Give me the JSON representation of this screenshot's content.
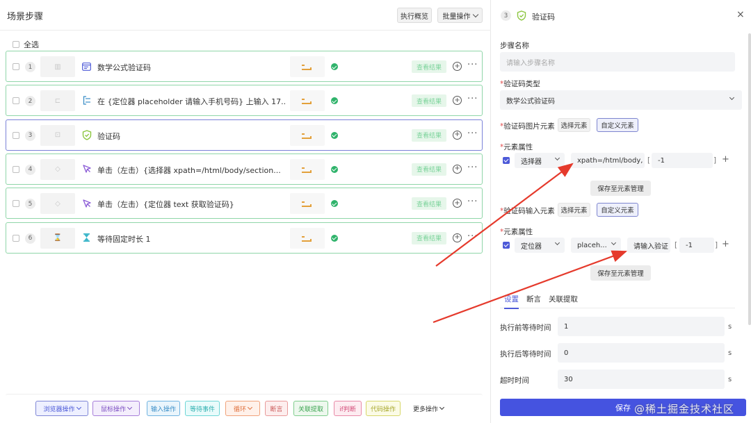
{
  "left_panel": {
    "title": "场景步骤",
    "run_overview_label": "执行概览",
    "batch_label": "批量操作",
    "select_all_label": "全选",
    "steps": [
      {
        "num": "1",
        "label": "数学公式验证码",
        "icon": "form-icon",
        "result": "查看结果"
      },
      {
        "num": "2",
        "label": "在 {定位器 placeholder 请输入手机号码} 上输入 17...",
        "icon": "input-bracket-icon",
        "result": "查看结果"
      },
      {
        "num": "3",
        "label": "验证码",
        "icon": "shield-check-icon",
        "result": "查看结果"
      },
      {
        "num": "4",
        "label": "单击（左击）{选择器 xpath=/html/body/section...",
        "icon": "cursor-click-icon",
        "result": "查看结果"
      },
      {
        "num": "5",
        "label": "单击（左击）{定位器 text 获取验证码}",
        "icon": "cursor-click-icon",
        "result": "查看结果"
      },
      {
        "num": "6",
        "label": "等待固定时长 1",
        "icon": "hourglass-icon",
        "result": "查看结果"
      }
    ],
    "toolbar": [
      {
        "label": "浏览器操作",
        "dropdown": true,
        "bg": "#eef0ff",
        "border": "#7e86d6",
        "color": "#4d5ad8"
      },
      {
        "label": "鼠标操作",
        "dropdown": true,
        "bg": "#f4eefc",
        "border": "#a67dd9",
        "color": "#7d4fc2"
      },
      {
        "label": "输入操作",
        "dropdown": false,
        "bg": "#eaf5fc",
        "border": "#6fb3e0",
        "color": "#3b8ec7"
      },
      {
        "label": "等待事件",
        "dropdown": false,
        "bg": "#e9fbfb",
        "border": "#6fd6d6",
        "color": "#2fb0b0"
      },
      {
        "label": "循环",
        "dropdown": true,
        "bg": "#fff1ea",
        "border": "#f0a27a",
        "color": "#e0713d"
      },
      {
        "label": "断言",
        "dropdown": false,
        "bg": "#fdeeee",
        "border": "#e99a9a",
        "color": "#cc5c5c"
      },
      {
        "label": "关联提取",
        "dropdown": false,
        "bg": "#edf8ee",
        "border": "#7fcd8d",
        "color": "#3da552"
      },
      {
        "label": "if判断",
        "dropdown": false,
        "bg": "#fdecf1",
        "border": "#e88aa8",
        "color": "#d44d7a"
      },
      {
        "label": "代码操作",
        "dropdown": false,
        "bg": "#fbfbe6",
        "border": "#d7d76a",
        "color": "#a8a82e"
      },
      {
        "label": "更多操作",
        "dropdown": true,
        "bg": "#ffffff",
        "border": "#ffffff",
        "color": "#333333"
      }
    ]
  },
  "right_panel": {
    "step_num": "3",
    "title": "验证码",
    "close": "×",
    "step_name_label": "步骤名称",
    "step_name_placeholder": "请输入步骤名称",
    "captcha_type_label": "验证码类型",
    "captcha_type_value": "数学公式验证码",
    "req_mark": "*",
    "img_element_label": "验证码图片元素",
    "select_element": "选择元素",
    "custom_element": "自定义元素",
    "attr_label": "元素属性",
    "attr1": {
      "type": "选择器",
      "value": "xpath=/html/body,",
      "index": "-1"
    },
    "save_to_manager": "保存至元素管理",
    "input_element_label": "验证码输入元素",
    "attr2": {
      "type": "定位器",
      "sub": "placeh...",
      "value": "请输入验证",
      "index": "-1"
    },
    "tabs": [
      "设置",
      "断言",
      "关联提取"
    ],
    "before_wait_label": "执行前等待时间",
    "before_wait_value": "1",
    "after_wait_label": "执行后等待时间",
    "after_wait_value": "0",
    "timeout_label": "超时时间",
    "timeout_value": "30",
    "unit": "s",
    "save_label": "保存",
    "bracket_open": "[",
    "bracket_close": "]",
    "add": "+"
  },
  "watermark": "@稀土掘金技术社区",
  "colors": {
    "accent": "#4553e0",
    "success": "#2fb36b",
    "arrow": "#e53a2c"
  }
}
